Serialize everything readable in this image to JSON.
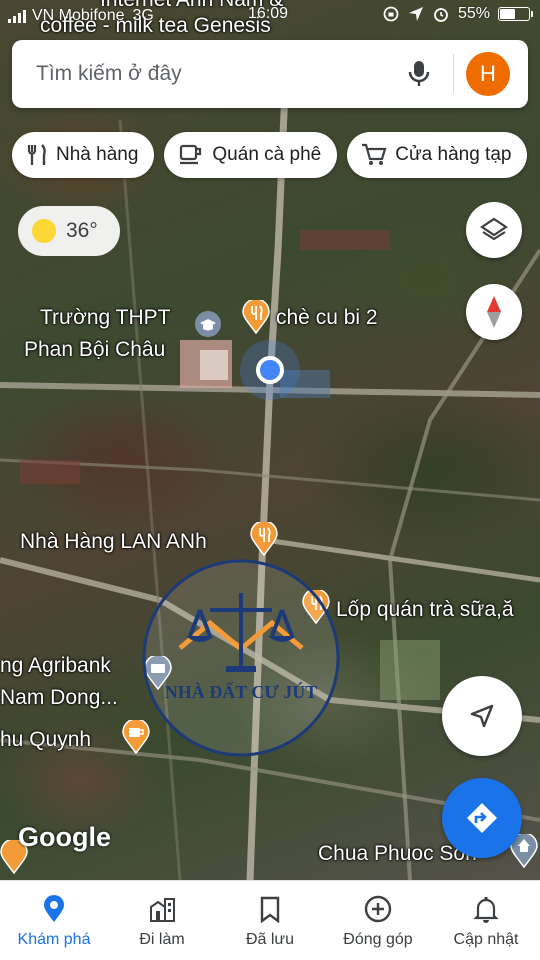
{
  "status_bar": {
    "carrier": "VN Mobifone",
    "network": "3G",
    "time": "16:09",
    "battery": "55%",
    "battery_level": 0.55
  },
  "map_top_labels": {
    "line1": "Internet Anh Nam &",
    "line2": "coffee - milk tea Genesis"
  },
  "search": {
    "placeholder": "Tìm kiếm ở đây",
    "avatar_letter": "H",
    "avatar_color": "#ef6c00"
  },
  "chips": [
    {
      "label": "Nhà hàng",
      "icon": "fork-knife-icon"
    },
    {
      "label": "Quán cà phê",
      "icon": "coffee-cup-icon"
    },
    {
      "label": "Cửa hàng tạp",
      "icon": "cart-icon"
    }
  ],
  "weather": {
    "temp": "36°"
  },
  "places": {
    "school_line1": "Trường THPT",
    "school_line2": "Phan Bội Châu",
    "che": "chè cu bi 2",
    "restaurant": "Nhà Hàng LAN ANh",
    "tea": "Lốp quán trà sữa,ă",
    "bank_line1": "ng Agribank",
    "bank_line2": "Nam Dong...",
    "cafe": "hu Quynh",
    "chua": "Chua Phuoc Son"
  },
  "watermark": {
    "text": "NHÀ ĐẤT CƯ JÚT"
  },
  "map_brand": "Google",
  "bottom_nav": [
    {
      "label": "Khám phá",
      "icon": "location-pin-icon",
      "active": true
    },
    {
      "label": "Đi làm",
      "icon": "building-icon",
      "active": false
    },
    {
      "label": "Đã lưu",
      "icon": "bookmark-icon",
      "active": false
    },
    {
      "label": "Đóng góp",
      "icon": "add-circle-icon",
      "active": false
    },
    {
      "label": "Cập nhật",
      "icon": "bell-icon",
      "active": false
    }
  ],
  "colors": {
    "accent": "#1a73e8",
    "pin": "#f29b38",
    "directions": "#1a73e8"
  }
}
